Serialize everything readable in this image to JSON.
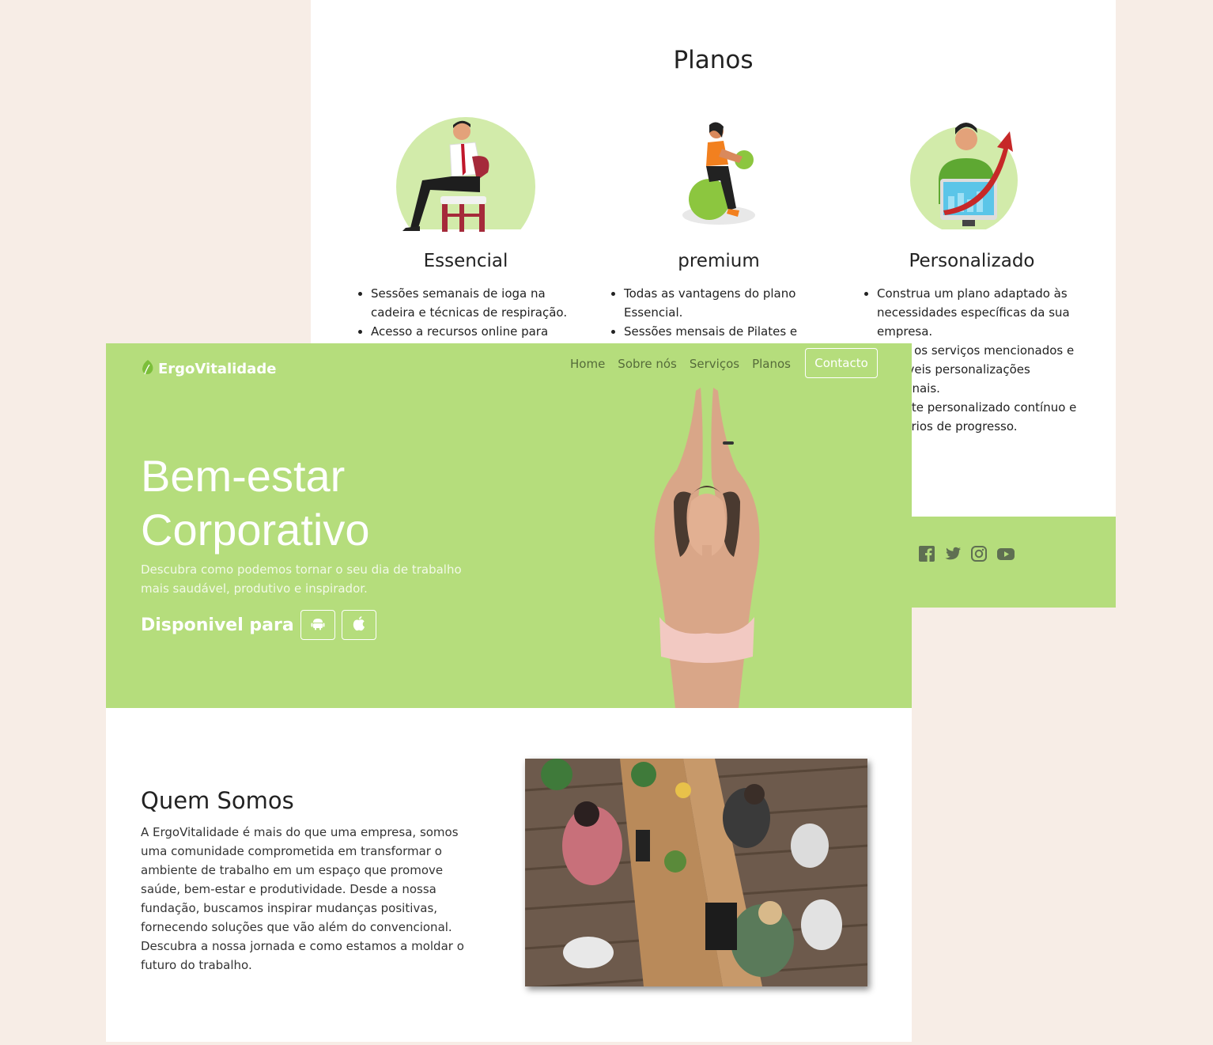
{
  "plans": {
    "title": "Planos",
    "items": [
      {
        "name": "Essencial",
        "features": [
          "Sessões semanais de ioga na cadeira e técnicas de respiração.",
          "Acesso a recursos online para"
        ]
      },
      {
        "name": "premium",
        "features": [
          "Todas as vantagens do plano Essencial.",
          "Sessões mensais de Pilates e"
        ]
      },
      {
        "name": "Personalizado",
        "features": [
          "Construa um plano adaptado às necessidades específicas da sua empresa.",
          "Todos os serviços mencionados e possíveis personalizações adicionais.",
          "Suporte personalizado contínuo e relatórios de progresso."
        ]
      }
    ]
  },
  "social": [
    "facebook-icon",
    "twitter-icon",
    "instagram-icon",
    "youtube-icon"
  ],
  "navbar": {
    "brand": "ErgoVitalidade",
    "links": [
      "Home",
      "Sobre nós",
      "Serviços",
      "Planos"
    ],
    "contact": "Contacto"
  },
  "hero": {
    "title": "Bem-estar Corporativo",
    "subtitle": "Descubra como podemos tornar o seu dia de trabalho mais saudável, produtivo e inspirador.",
    "available_label": "Disponivel para",
    "stores": [
      "android-icon",
      "apple-icon"
    ]
  },
  "about": {
    "title": "Quem Somos",
    "text": "A ErgoVitalidade é mais do que uma empresa, somos uma comunidade comprometida em transformar o ambiente de trabalho em um espaço que promove saúde, bem-estar e produtividade. Desde a nossa fundação, buscamos inspirar mudanças positivas, fornecendo soluções que vão além do convencional. Descubra a nossa jornada e como estamos a moldar o futuro do trabalho."
  },
  "colors": {
    "accent": "#b5dd7c",
    "page_bg": "#f7ede6"
  }
}
